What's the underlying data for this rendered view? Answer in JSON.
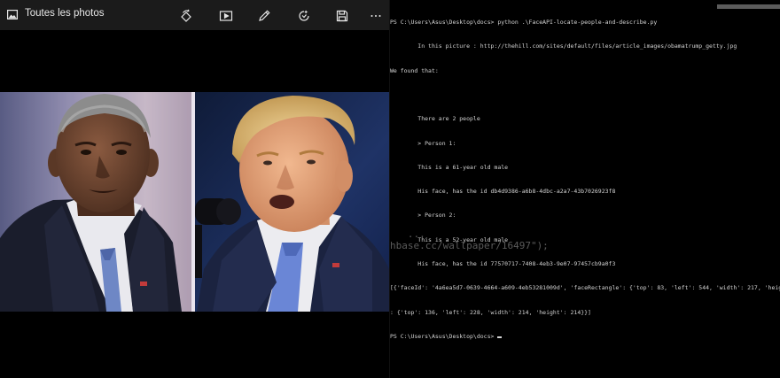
{
  "photos_app": {
    "title": "Toutes les photos",
    "toolbar": {
      "buttons": [
        {
          "name": "rotate-button",
          "icon": "rotate-icon"
        },
        {
          "name": "slideshow-button",
          "icon": "slideshow-icon"
        },
        {
          "name": "edit-button",
          "icon": "pencil-icon"
        },
        {
          "name": "enhance-button",
          "icon": "enhance-icon"
        },
        {
          "name": "save-button",
          "icon": "save-icon"
        },
        {
          "name": "more-button",
          "icon": "more-icon",
          "label": "···"
        }
      ]
    },
    "image": {
      "left_subject": "older man with gray hair, dark suit, white shirt, light blue patterned tie, flag pin",
      "right_subject": "man with blond hair speaking, dark suit, white shirt, light blue tie, flag pin, microphone"
    }
  },
  "terminal": {
    "lines": [
      "PS C:\\Users\\Asus\\Desktop\\docs> python .\\FaceAPI-locate-people-and-describe.py",
      "        In this picture : http://thehill.com/sites/default/files/article_images/obamatrump_getty.jpg",
      "We found that:",
      "",
      "        There are 2 people",
      "        > Person 1:",
      "        This is a 61-year old male",
      "        His face, has the id db4d9386-a6b8-4dbc-a2a7-43b7026923f8",
      "        > Person 2:",
      "        This is a 52-year old male",
      "        His face, has the id 77570717-7408-4eb3-9e07-97457cb9a0f3",
      "[{'faceId': '4a6ea5d7-0639-4664-a609-4eb53281009d', 'faceRectangle': {'top': 83, 'left': 544, 'width': 217, 'height': 217}}, {'faceId': '...', 'faceRectangle'",
      ": {'top': 136, 'left': 228, 'width': 214, 'height': 214}}]",
      "PS C:\\Users\\Asus\\Desktop\\docs> "
    ],
    "ghost_text": [
      "   ...",
      "hbase.cc/wallpaper/16497\");"
    ],
    "colors": {
      "background": "#000000",
      "text": "#d4d4d4"
    }
  }
}
